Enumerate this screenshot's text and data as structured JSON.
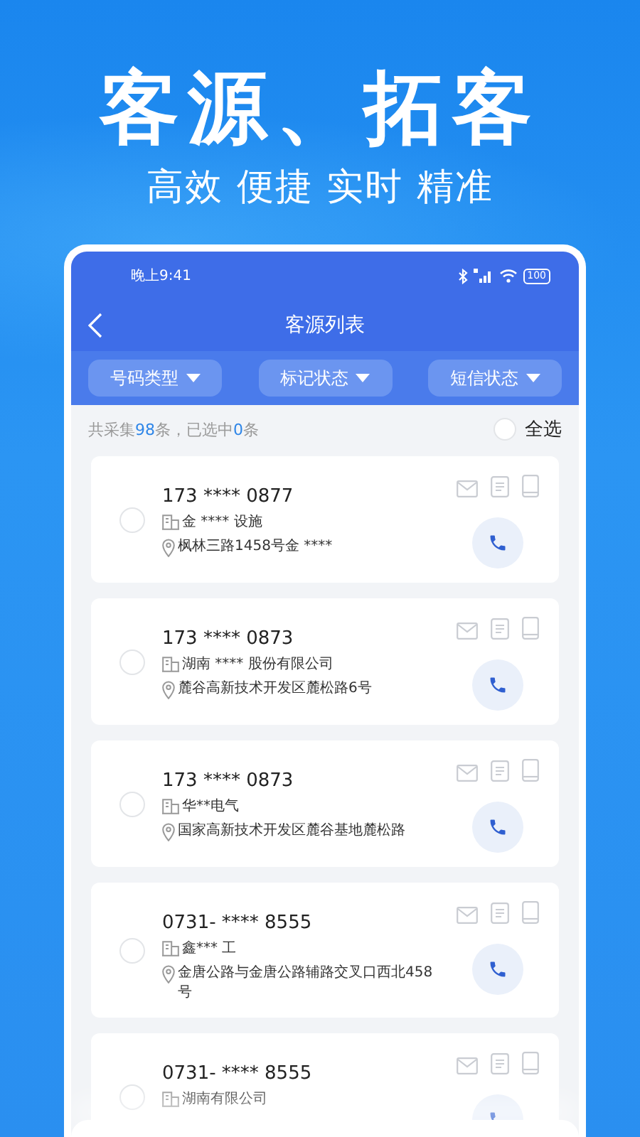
{
  "headline": "客源、拓客",
  "tagline": "高效 便捷 实时 精准",
  "status_bar": {
    "time": "晚上9:41",
    "battery": "100"
  },
  "nav": {
    "title": "客源列表"
  },
  "filters": [
    {
      "label": "号码类型"
    },
    {
      "label": "标记状态"
    },
    {
      "label": "短信状态"
    }
  ],
  "summary": {
    "parts": [
      {
        "text": "共采集",
        "highlight": false
      },
      {
        "text": "98",
        "highlight": true
      },
      {
        "text": "条，已选中",
        "highlight": false
      },
      {
        "text": "0",
        "highlight": true
      },
      {
        "text": "条",
        "highlight": false
      }
    ],
    "select_all": {
      "label": "全选",
      "checked": false
    }
  },
  "contacts": [
    {
      "phone": "173 **** 0877",
      "company": "金 ****  设施",
      "address": "枫林三路1458号金 ****",
      "selected": false
    },
    {
      "phone": "173 **** 0873",
      "company": "湖南 **** 股份有限公司",
      "address": "麓谷高新技术开发区麓松路6号",
      "selected": false
    },
    {
      "phone": "173 **** 0873",
      "company": "华**电气",
      "address": "国家高新技术开发区麓谷基地麓松路",
      "selected": false
    },
    {
      "phone": "0731- **** 8555",
      "company": "鑫*** 工",
      "address": "金唐公路与金唐公路辅路交叉口西北458号",
      "selected": false
    },
    {
      "phone": "0731- **** 8555",
      "company": "湖南有限公司",
      "selected": false
    }
  ]
}
